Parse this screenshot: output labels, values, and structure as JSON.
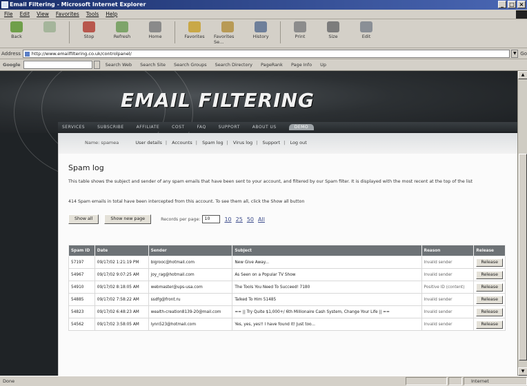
{
  "window": {
    "title": "Email Filtering - Microsoft Internet Explorer"
  },
  "menu": [
    "File",
    "Edit",
    "View",
    "Favorites",
    "Tools",
    "Help"
  ],
  "toolbar": {
    "buttons": [
      {
        "label": "Back",
        "icon": "back-arrow-icon"
      },
      {
        "label": "",
        "icon": "forward-arrow-icon"
      },
      {
        "label": "Stop",
        "icon": "stop-icon"
      },
      {
        "label": "Refresh",
        "icon": "refresh-icon"
      },
      {
        "label": "Home",
        "icon": "home-icon"
      },
      {
        "label": "Favorites",
        "icon": "favorites-icon"
      },
      {
        "label": "Favorites Se...",
        "icon": "favorites-search-icon"
      },
      {
        "label": "History",
        "icon": "history-icon"
      },
      {
        "label": "Print",
        "icon": "print-icon"
      },
      {
        "label": "Size",
        "icon": "font-size-icon"
      },
      {
        "label": "Edit",
        "icon": "edit-icon"
      }
    ]
  },
  "address": {
    "label": "Address",
    "url": "http://www.emailfiltering.co.uk/controlpanel/",
    "go": "Go"
  },
  "googlebar": {
    "logo": "Google",
    "items": [
      "Search Web",
      "Search Site",
      "Search Groups",
      "Search Directory",
      "PageRank",
      "Page Info",
      "Up"
    ]
  },
  "site": {
    "logo": "EMAIL FILTERING",
    "nav": [
      "SERVICES",
      "SUBSCRIBE",
      "AFFILIATE",
      "COST",
      "FAQ",
      "SUPPORT",
      "ABOUT US",
      "DEMO"
    ],
    "account": {
      "name": "Name: spamea",
      "links": [
        "User details",
        "Accounts",
        "Spam log",
        "Virus log",
        "Support",
        "Log out"
      ]
    },
    "heading": "Spam log",
    "intro": "This table shows the subject and sender of any spam emails that have been sent to your account, and filtered by our Spam filter. It is displayed with the most recent at the top of the list",
    "count_note": "414 Spam emails in total have been intercepted from this account. To see them all, click the Show all button",
    "controls": {
      "show_all": "Show all",
      "show_new_page": "Show new page",
      "rpp_label": "Records per page:",
      "rpp_value": "10",
      "rpp_options": [
        "10",
        "25",
        "50",
        "All"
      ]
    },
    "table": {
      "headers": [
        "Spam ID",
        "Date",
        "Sender",
        "Subject",
        "Reason",
        "Release"
      ],
      "rows": [
        {
          "id": "57197",
          "date": "09/17/02 1:21:19 PM",
          "sender": "bigrooc@hotmail.com",
          "subject": "New Give Away...",
          "reason": "Invalid sender",
          "release": "Release"
        },
        {
          "id": "54967",
          "date": "09/17/02 9:07:25 AM",
          "sender": "joy_rag@hotmail.com",
          "subject": "As Seen on a Popular TV Show",
          "reason": "Invalid sender",
          "release": "Release"
        },
        {
          "id": "54910",
          "date": "09/17/02 8:18:05 AM",
          "sender": "webmaster@ups-usa.com",
          "subject": "The Tools You Need To Succeed! 7180",
          "reason": "Positive ID (content)",
          "release": "Release"
        },
        {
          "id": "54885",
          "date": "09/17/02 7:58:22 AM",
          "sender": "ssdfg@front.ru",
          "subject": "Talked To Him 51485",
          "reason": "Invalid sender",
          "release": "Release"
        },
        {
          "id": "54823",
          "date": "09/17/02 6:48:23 AM",
          "sender": "wealth-creation8139-20@mail.com",
          "subject": "== || Try Quite $1,000+/ 6th Millionaire Cash System, Change Your Life || ==",
          "reason": "Invalid sender",
          "release": "Release"
        },
        {
          "id": "54562",
          "date": "09/17/02 3:58:05 AM",
          "sender": "lynn523@hotmail.com",
          "subject": "Yes, yes, yes!! I have found it! Just too...",
          "reason": "Invalid sender",
          "release": "Release"
        }
      ]
    }
  },
  "status": {
    "text": "Done",
    "zone": "Internet"
  },
  "colors": {
    "title_bar": "#1a2f6b",
    "chrome": "#d4d0c8",
    "banner": "#2c3033",
    "table_header": "#6d7276"
  }
}
